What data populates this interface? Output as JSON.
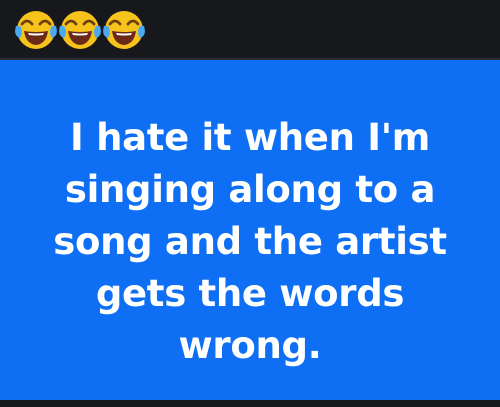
{
  "header": {
    "emojis": [
      "face-with-tears-of-joy-icon",
      "face-with-tears-of-joy-icon",
      "face-with-tears-of-joy-icon"
    ]
  },
  "card": {
    "background_color": "#0e6ff5",
    "text_color": "#ffffff",
    "text": "I hate it when I'm singing along to a song and the artist gets the words wrong."
  }
}
